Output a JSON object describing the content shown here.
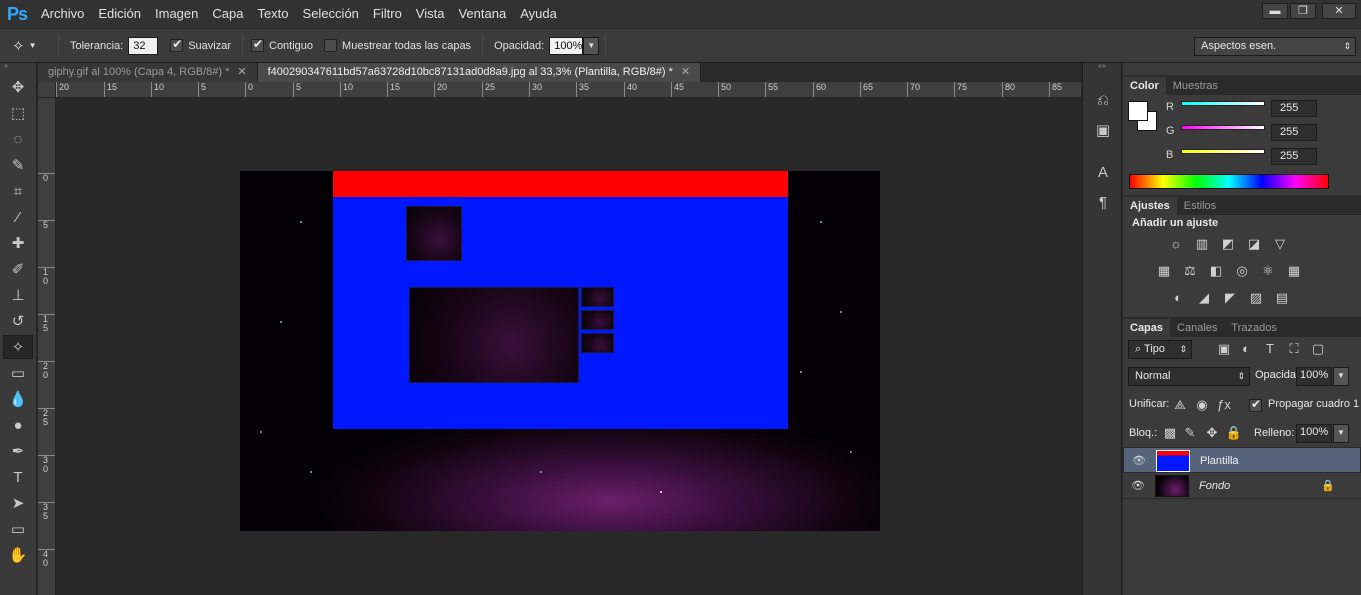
{
  "app": {
    "logo": "Ps"
  },
  "menu": [
    "Archivo",
    "Edición",
    "Imagen",
    "Capa",
    "Texto",
    "Selección",
    "Filtro",
    "Vista",
    "Ventana",
    "Ayuda"
  ],
  "window_controls": {
    "minimize": "▬",
    "restore": "❐",
    "close": "✕"
  },
  "options": {
    "tolerance_label": "Tolerancia:",
    "tolerance_value": "32",
    "smooth_label": "Suavizar",
    "contiguous_label": "Contiguo",
    "sample_all_label": "Muestrear todas las capas",
    "opacity_label": "Opacidad:",
    "opacity_value": "100%",
    "workspace": "Aspectos esen."
  },
  "doc_tabs": [
    {
      "label": "giphy.gif al 100% (Capa 4, RGB/8#) *",
      "active": false
    },
    {
      "label": "f400290347611bd57a63728d10bc87131ad0d8a9.jpg al 33,3% (Plantilla, RGB/8#) *",
      "active": true
    }
  ],
  "ruler_h": [
    "20",
    "15",
    "10",
    "5",
    "0",
    "5",
    "10",
    "15",
    "20",
    "25",
    "30",
    "35",
    "40",
    "45",
    "50",
    "55",
    "60",
    "65",
    "70",
    "75",
    "80",
    "85"
  ],
  "ruler_v": [
    "0",
    "5",
    "1\n0",
    "1\n5",
    "2\n0",
    "2\n5",
    "3\n0",
    "3\n5",
    "4\n0"
  ],
  "color_panel": {
    "tabs": [
      "Color",
      "Muestras"
    ],
    "r_label": "R",
    "g_label": "G",
    "b_label": "B",
    "r_value": "255",
    "g_value": "255",
    "b_value": "255"
  },
  "adjust_panel": {
    "tabs": [
      "Ajustes",
      "Estilos"
    ],
    "heading": "Añadir un ajuste"
  },
  "layers_panel": {
    "tabs": [
      "Capas",
      "Canales",
      "Trazados"
    ],
    "filter_kind": "Tipo",
    "blend_mode": "Normal",
    "opacity_label": "Opacidad:",
    "opacity_value": "100%",
    "unify_label": "Unificar:",
    "propagate_label": "Propagar cuadro 1",
    "lock_label": "Bloq.:",
    "fill_label": "Relleno:",
    "fill_value": "100%",
    "layers": [
      {
        "name": "Plantilla",
        "selected": true
      },
      {
        "name": "Fondo",
        "selected": false,
        "locked": true
      }
    ]
  },
  "colors": {
    "red_bar": "#ff0000",
    "blue_panel": "#0018ff",
    "accent": "#31a8ff"
  }
}
